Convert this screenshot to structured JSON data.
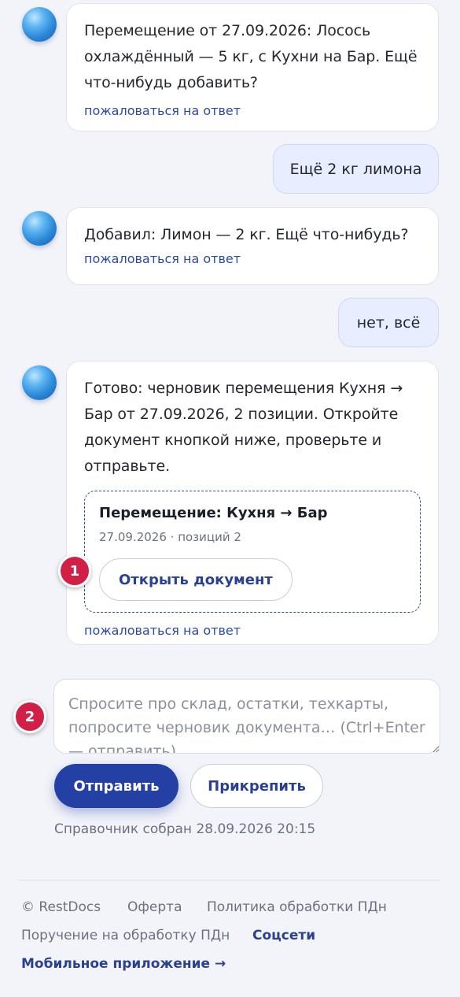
{
  "messages": [
    {
      "role": "bot",
      "text": "Перемещение от 27.09.2026: Лосось охлаждённый — 5 кг, с Кухни на Бар. Ещё что-нибудь добавить?",
      "report_link": "пожаловаться на ответ"
    },
    {
      "role": "user",
      "text": "Ещё 2 кг лимона"
    },
    {
      "role": "bot",
      "text": "Добавил: Лимон — 2 кг. Ещё что-нибудь?",
      "report_link": "пожаловаться на ответ"
    },
    {
      "role": "user",
      "text": "нет, всё"
    },
    {
      "role": "bot",
      "text": "Готово: черновик перемещения Кухня → Бар от 27.09.2026, 2 позиции. Откройте документ кнопкой ниже, проверьте и отправьте.",
      "document": {
        "title": "Перемещение: Кухня → Бар",
        "meta": "27.09.2026 · позиций 2",
        "open_label": "Открыть документ"
      },
      "report_link": "пожаловаться на ответ"
    }
  ],
  "markers": {
    "first": "1",
    "second": "2"
  },
  "composer": {
    "placeholder": "Спросите про склад, остатки, техкарты, попросите черновик документа… (Ctrl+Enter — отправить)",
    "send_label": "Отправить",
    "attach_label": "Прикрепить",
    "reference_note": "Справочник собран 28.09.2026 20:15"
  },
  "footer": {
    "copyright": "© RestDocs",
    "offer": "Оферта",
    "privacy_policy": "Политика обработки ПДн",
    "processing_order": "Поручение на обработку ПДн",
    "socials": "Соцсети",
    "mobile_app": "Мобильное приложение →"
  },
  "colors": {
    "page_background": "#f3f4f9",
    "primary": "#2540a4",
    "link": "#2a4aa6",
    "user_bubble": "#e8eeff",
    "marker": "#d21f46"
  }
}
